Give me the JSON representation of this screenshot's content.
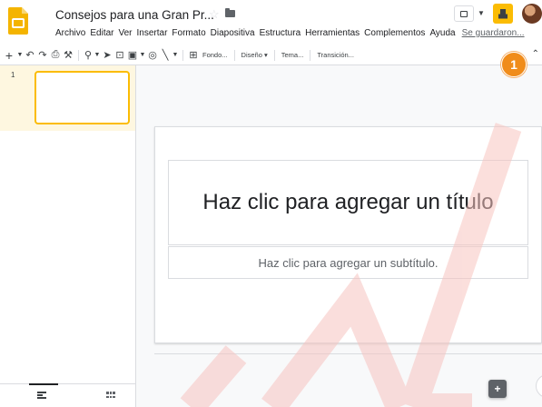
{
  "header": {
    "title": "Consejos para una Gran Pr...",
    "star_icon": "star-icon",
    "folder_icon": "folder-icon",
    "menu": [
      "Archivo",
      "Editar",
      "Ver",
      "Insertar",
      "Formato",
      "Diapositiva",
      "Estructura",
      "Herramientas",
      "Complementos",
      "Ayuda"
    ],
    "saved_status": "Se guardaron...",
    "step_badge": "1"
  },
  "toolbar": {
    "background_label": "Fondo...",
    "layout_label": "Diseño",
    "theme_label": "Tema...",
    "transition_label": "Transición..."
  },
  "filmstrip": {
    "slides": [
      {
        "number": "1"
      }
    ]
  },
  "slide": {
    "title_placeholder": "Haz clic para agregar un título",
    "subtitle_placeholder": "Haz clic para agregar un subtítulo."
  },
  "colors": {
    "accent": "#fbbc04",
    "badge": "#f08c1a",
    "selected_row": "#fef7e0",
    "watermark": "#f4b4b0"
  }
}
